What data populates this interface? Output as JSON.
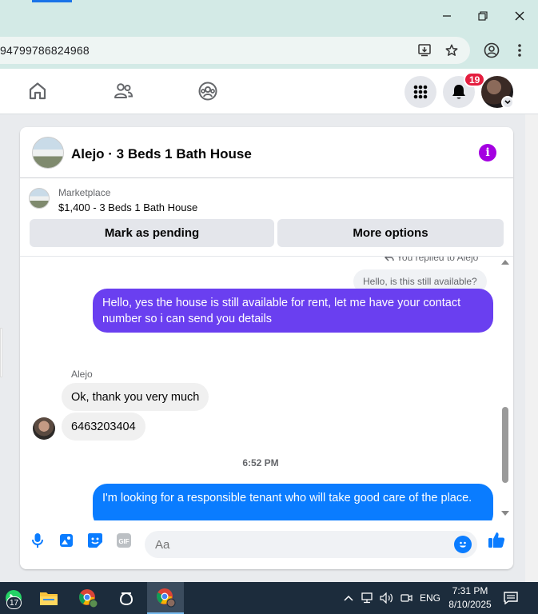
{
  "browser": {
    "url": "94799786824968",
    "icons": [
      "minimize-icon",
      "restore-icon",
      "close-icon",
      "install-app-icon",
      "bookmark-star-icon",
      "profile-icon",
      "menu-dots-icon"
    ]
  },
  "facebook_nav": {
    "notifications_count": "19",
    "icons": [
      "home-icon",
      "friends-icon",
      "groups-icon",
      "menu-grid-icon",
      "bell-icon"
    ]
  },
  "chat": {
    "title": "Alejo · 3 Beds 1 Bath House",
    "listing": {
      "source": "Marketplace",
      "title": "$1,400 - 3 Beds 1 Bath House",
      "mark_pending_label": "Mark as pending",
      "more_options_label": "More options"
    },
    "messages": {
      "replied_note": "You replied to Alejo",
      "quoted_text": "Hello, is this still available?",
      "outgoing_1": "Hello, yes the house is still available for rent, let me have your contact number so i can send you details",
      "sender_name": "Alejo",
      "incoming_1": "Ok, thank you very much",
      "incoming_2": "6463203404",
      "time_separator": "6:52 PM",
      "outgoing_2": "I'm looking for a responsible tenant who will take good care of the place."
    },
    "composer": {
      "placeholder": "Aa",
      "icons": [
        "microphone-icon",
        "image-icon",
        "sticker-icon",
        "gif-icon",
        "emoji-icon",
        "thumbs-up-icon"
      ],
      "gif_label": "GIF"
    },
    "colors": {
      "outgoing_purple": "#6a3ff0",
      "outgoing_blue": "#0a7cff",
      "messenger_accent": "#0a7cff",
      "info_purple": "#a400e1"
    }
  },
  "taskbar": {
    "whatsapp_badge": "17",
    "language": "ENG",
    "time": "7:31 PM",
    "date": "8/10/2025"
  }
}
